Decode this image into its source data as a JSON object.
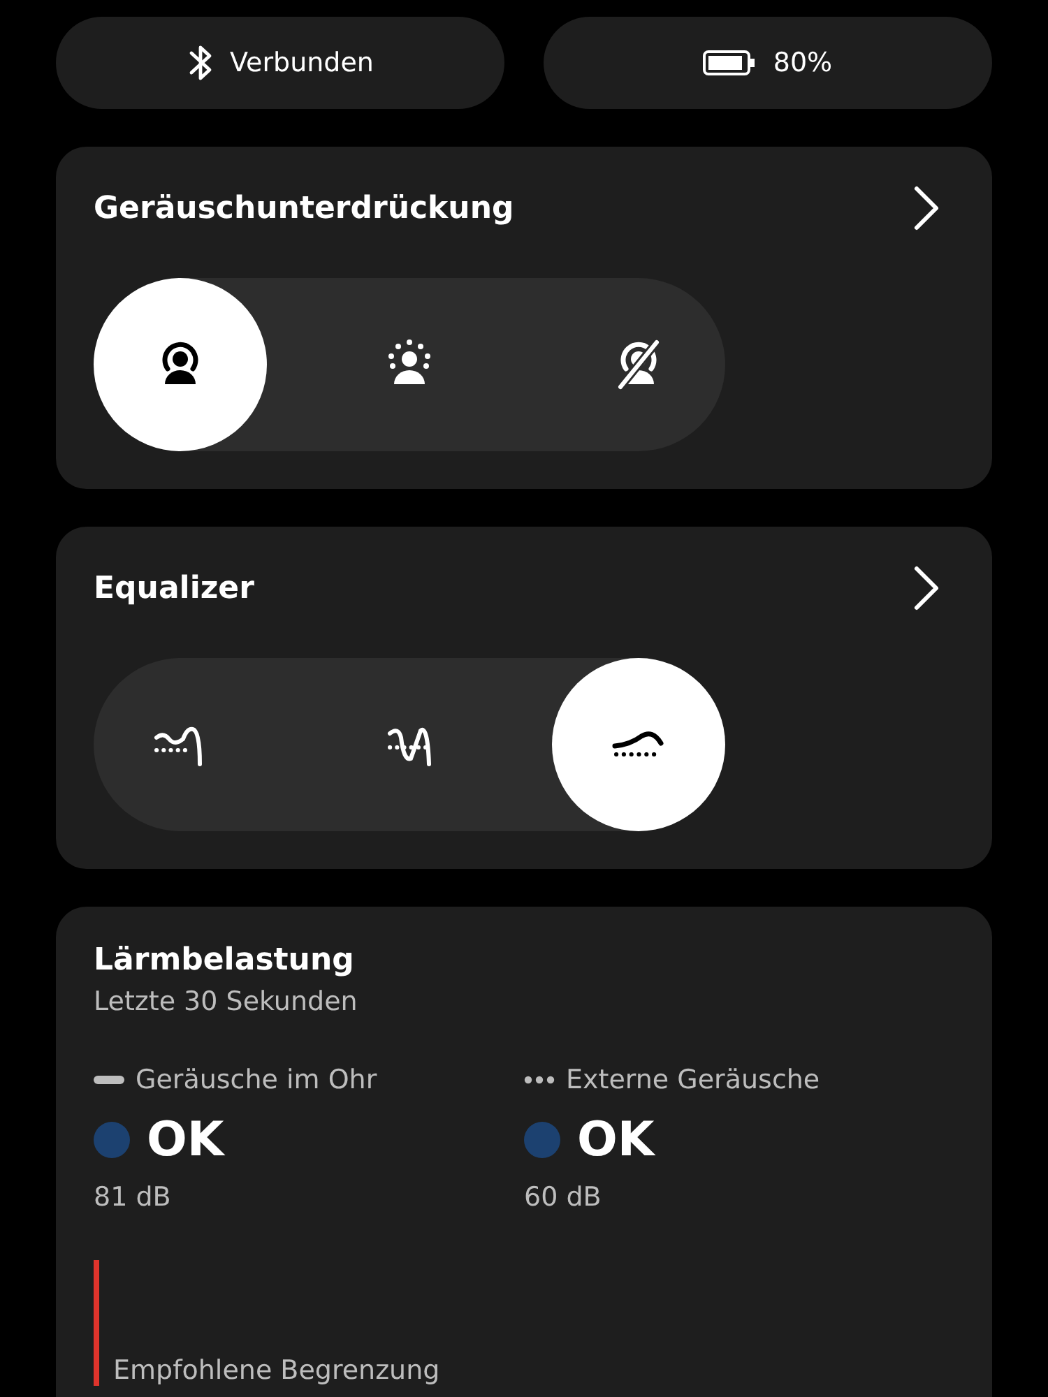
{
  "status_pills": [
    {
      "kind": "bluetooth",
      "label": "Verbunden"
    },
    {
      "kind": "battery",
      "label": "80%"
    }
  ],
  "noise_control": {
    "title": "Geräuschunterdrückung",
    "modes": [
      {
        "kind": "anc",
        "selected": true
      },
      {
        "kind": "transparency",
        "selected": false
      },
      {
        "kind": "off",
        "selected": false
      }
    ]
  },
  "equalizer": {
    "title": "Equalizer",
    "presets": [
      {
        "kind": "bass",
        "selected": false
      },
      {
        "kind": "vocal",
        "selected": false
      },
      {
        "kind": "flat",
        "selected": true
      }
    ]
  },
  "noise_exposure": {
    "title": "Lärmbelastung",
    "subtitle": "Letzte 30 Sekunden",
    "readings": [
      {
        "kind": "solid",
        "label": "Geräusche im Ohr",
        "status": "OK",
        "color": "#1c4170",
        "value": "81 dB"
      },
      {
        "kind": "dotted",
        "label": "Externe Geräusche",
        "status": "OK",
        "color": "#1c4170",
        "value": "60 dB"
      }
    ],
    "limit_label": "Empfohlene Begrenzung"
  }
}
